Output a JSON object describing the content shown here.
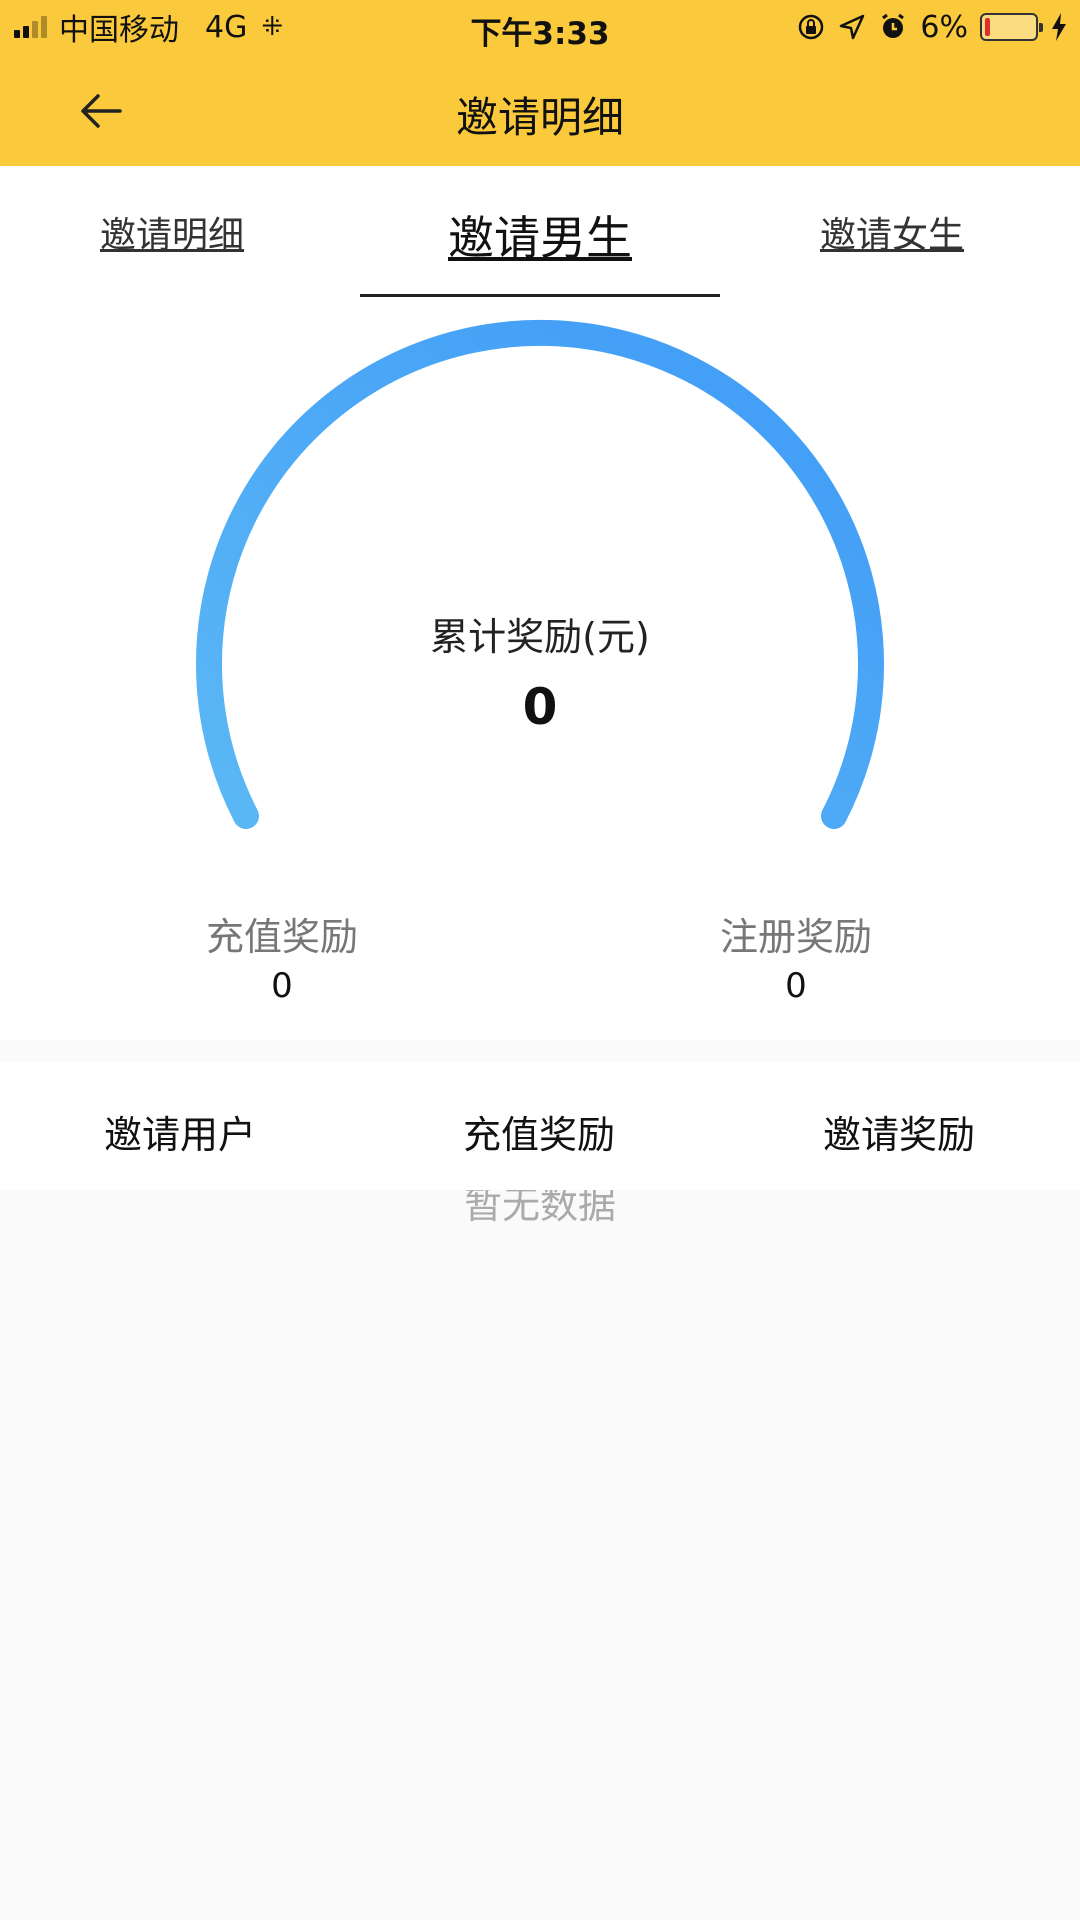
{
  "status_bar": {
    "carrier": "中国移动",
    "network": "4G",
    "time": "下午3:33",
    "battery": "6%",
    "icons": [
      "signal-bars-icon",
      "loading-spinner-icon",
      "orientation-lock-icon",
      "location-arrow-icon",
      "alarm-clock-icon",
      "battery-icon",
      "charging-bolt-icon"
    ]
  },
  "header": {
    "title": "邀请明细",
    "back_icon": "back-arrow-icon"
  },
  "tabs": [
    {
      "label": "邀请明细"
    },
    {
      "label": "邀请男生",
      "active": true
    },
    {
      "label": "邀请女生"
    }
  ],
  "gauge": {
    "label": "累计奖励(元)",
    "value": "0",
    "colors": [
      "#5bb8f5",
      "#3f9af6"
    ]
  },
  "stats": [
    {
      "label": "充值奖励",
      "value": "0"
    },
    {
      "label": "注册奖励",
      "value": "0"
    }
  ],
  "table": {
    "columns": [
      "邀请用户",
      "充值奖励",
      "邀请奖励"
    ],
    "empty_text": "暂无数据"
  },
  "colors": {
    "header_bg": "#fbc93c",
    "page_bg": "#fafafa",
    "gauge_start": "#5bb8f5",
    "gauge_end": "#3f9af6"
  }
}
